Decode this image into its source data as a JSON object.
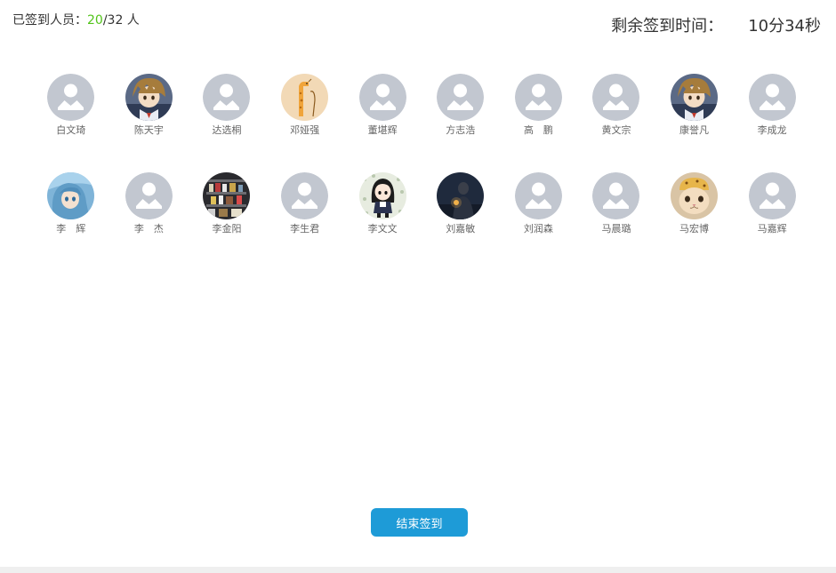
{
  "header": {
    "signed_label": "已签到人员：",
    "signed_count": "20",
    "total_suffix": "/32 人",
    "remaining_label": "剩余签到时间：",
    "remaining_time": "10分34秒"
  },
  "people": [
    {
      "name": "白文琦",
      "avatar": "default-user-icon"
    },
    {
      "name": "陈天宇",
      "avatar": "anime-boy-avatar"
    },
    {
      "name": "达选桐",
      "avatar": "default-user-icon"
    },
    {
      "name": "邓娅强",
      "avatar": "giraffe-avatar"
    },
    {
      "name": "董堪辉",
      "avatar": "default-user-icon"
    },
    {
      "name": "方志浩",
      "avatar": "default-user-icon"
    },
    {
      "name": "高　鹏",
      "avatar": "default-user-icon"
    },
    {
      "name": "黄文宗",
      "avatar": "default-user-icon"
    },
    {
      "name": "康誉凡",
      "avatar": "anime-boy-avatar"
    },
    {
      "name": "李成龙",
      "avatar": "default-user-icon"
    },
    {
      "name": "李　辉",
      "avatar": "anime-girl-blue-avatar"
    },
    {
      "name": "李　杰",
      "avatar": "default-user-icon"
    },
    {
      "name": "李金阳",
      "avatar": "store-shelf-photo-avatar"
    },
    {
      "name": "李生君",
      "avatar": "default-user-icon"
    },
    {
      "name": "李文文",
      "avatar": "chibi-girl-avatar"
    },
    {
      "name": "刘嘉敏",
      "avatar": "night-portrait-avatar"
    },
    {
      "name": "刘润森",
      "avatar": "default-user-icon"
    },
    {
      "name": "马晨璐",
      "avatar": "default-user-icon"
    },
    {
      "name": "马宏博",
      "avatar": "cat-avatar"
    },
    {
      "name": "马嘉辉",
      "avatar": "default-user-icon"
    }
  ],
  "end_button_label": "结束签到",
  "colors": {
    "signed_count": "#52c41a",
    "button": "#1e9bd7",
    "default_avatar_bg": "#c2c7d0"
  }
}
